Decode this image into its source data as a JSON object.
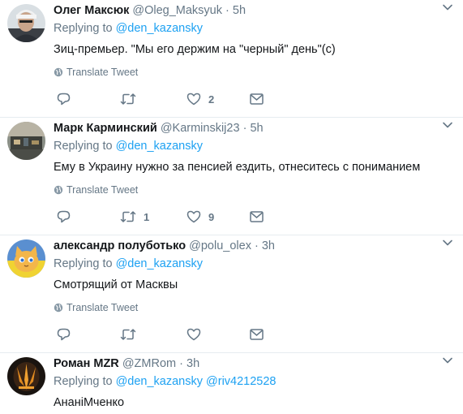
{
  "reply_prefix": "Replying to",
  "translate_label": "Translate Tweet",
  "icons": {
    "reply": "reply-icon",
    "retweet": "retweet-icon",
    "like": "heart-icon",
    "dm": "envelope-icon",
    "translate": "globe-icon",
    "more": "chevron-down-icon"
  },
  "colors": {
    "link": "#1da1f2",
    "muted": "#657786",
    "text": "#14171a",
    "divider": "#e6ecf0"
  },
  "tweets": [
    {
      "name": "Олег Максюк",
      "handle": "@Oleg_Maksyuk",
      "dot": "·",
      "time": "5h",
      "mentions": "@den_kazansky",
      "text": "Зиц-премьер. \"Мы его держим на \"черный\" день\"(с)",
      "replies": "",
      "retweets": "",
      "likes": "2"
    },
    {
      "name": "Марк Карминский",
      "handle": "@Karminskij23",
      "dot": "·",
      "time": "5h",
      "mentions": "@den_kazansky",
      "text": "Ему в Украину нужно за пенсией ездить, отнеситесь с пониманием",
      "replies": "",
      "retweets": "1",
      "likes": "9"
    },
    {
      "name": "александр полуботько",
      "handle": "@polu_olex",
      "dot": "·",
      "time": "3h",
      "mentions": "@den_kazansky",
      "text": "Смотрящий от Масквы",
      "replies": "",
      "retweets": "",
      "likes": ""
    },
    {
      "name": "Роман MZR",
      "handle": "@ZMRom",
      "dot": "·",
      "time": "3h",
      "mentions": "@den_kazansky @riv4212528",
      "text": "АнаніМченко",
      "replies": "",
      "retweets": "",
      "likes": ""
    }
  ]
}
